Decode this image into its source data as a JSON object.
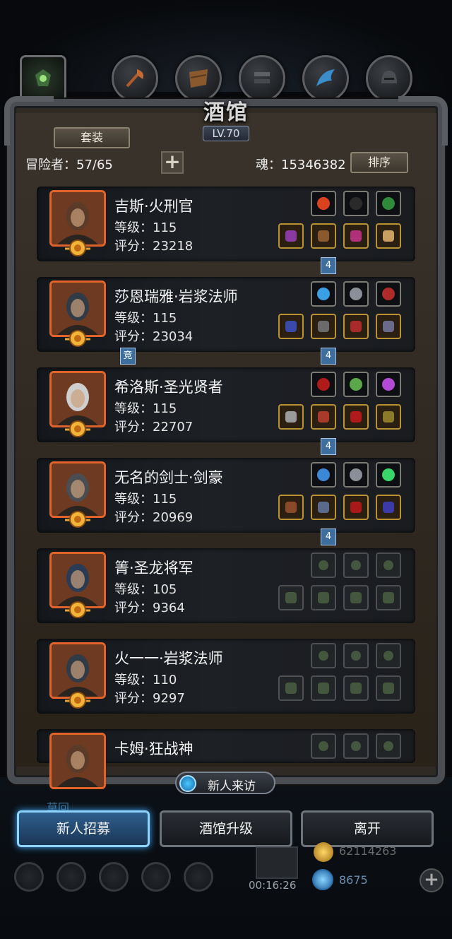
{
  "header": {
    "title": "酒馆",
    "level": "LV.70",
    "suit_button": "套装",
    "adventurers_label": "冒险者：57/65",
    "soul_label": "魂：15346382",
    "sort_button": "排序",
    "plus_symbol": "+"
  },
  "top_icons": [
    "guild-icon",
    "axe-icon",
    "shield-icon",
    "armor-icon",
    "wing-icon",
    "helmet-icon"
  ],
  "heroes": [
    {
      "name": "吉斯·火刑官",
      "level": "等级：115",
      "score": "评分：23218",
      "tag_right": "4",
      "tag_left": ""
    },
    {
      "name": "莎恩瑞雅·岩浆法师",
      "level": "等级：115",
      "score": "评分：23034",
      "tag_right": "4",
      "tag_left": "竞"
    },
    {
      "name": "希洛斯·圣光贤者",
      "level": "等级：115",
      "score": "评分：22707",
      "tag_right": "4",
      "tag_left": ""
    },
    {
      "name": "无名的剑士·剑豪",
      "level": "等级：115",
      "score": "评分：20969",
      "tag_right": "4",
      "tag_left": ""
    },
    {
      "name": "箐·圣龙将军",
      "level": "等级：105",
      "score": "评分：9364",
      "tag_right": "",
      "tag_left": ""
    },
    {
      "name": "火一一·岩浆法师",
      "level": "等级：110",
      "score": "评分：9297",
      "tag_right": "",
      "tag_left": ""
    },
    {
      "name": "卡姆·狂战神",
      "level": "",
      "score": "",
      "tag_right": "",
      "tag_left": ""
    }
  ],
  "footer": {
    "visit_button": "新人来访",
    "recruit_button": "新人招募",
    "upgrade_button": "酒馆升级",
    "leave_button": "离开",
    "timer": "00:16:26",
    "gold": "62114263",
    "gems": "8675",
    "faded_label": "莫回"
  },
  "colors": {
    "portrait_border": "#e0632a",
    "equip_gold": "#b99332",
    "active_button": "#8fd3ff",
    "tag_blue": "#3d6e9e"
  }
}
